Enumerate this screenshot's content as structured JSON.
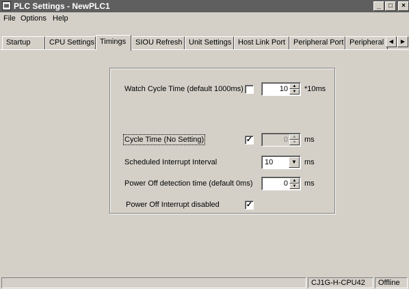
{
  "window": {
    "title": "PLC Settings - NewPLC1",
    "controls": {
      "minimize": "_",
      "maximize": "□",
      "close": "×"
    }
  },
  "menu": [
    {
      "label": "File"
    },
    {
      "label": "Options"
    },
    {
      "label": "Help"
    }
  ],
  "tabs": [
    {
      "label": "Startup"
    },
    {
      "label": "CPU Settings"
    },
    {
      "label": "Timings",
      "active": true
    },
    {
      "label": "SIOU Refresh"
    },
    {
      "label": "Unit Settings"
    },
    {
      "label": "Host Link Port"
    },
    {
      "label": "Peripheral Port"
    },
    {
      "label": "Peripheral Service"
    }
  ],
  "timings": {
    "watch_cycle": {
      "label": "Watch Cycle Time (default 1000ms)",
      "checked": false,
      "value": "10",
      "unit": "*10ms"
    },
    "cycle_time": {
      "label": "Cycle Time (No Setting)",
      "checked": true,
      "value": "0",
      "unit": "ms",
      "value_disabled": true
    },
    "scheduled_interrupt": {
      "label": "Scheduled Interrupt Interval",
      "value": "10",
      "unit": "ms"
    },
    "power_off_detection": {
      "label": "Power Off detection time (default 0ms)",
      "value": "0",
      "unit": "ms"
    },
    "power_off_interrupt": {
      "label": "Power Off Interrupt disabled",
      "checked": true
    }
  },
  "status": {
    "model": "CJ1G-H-CPU42",
    "mode": "Offline"
  }
}
